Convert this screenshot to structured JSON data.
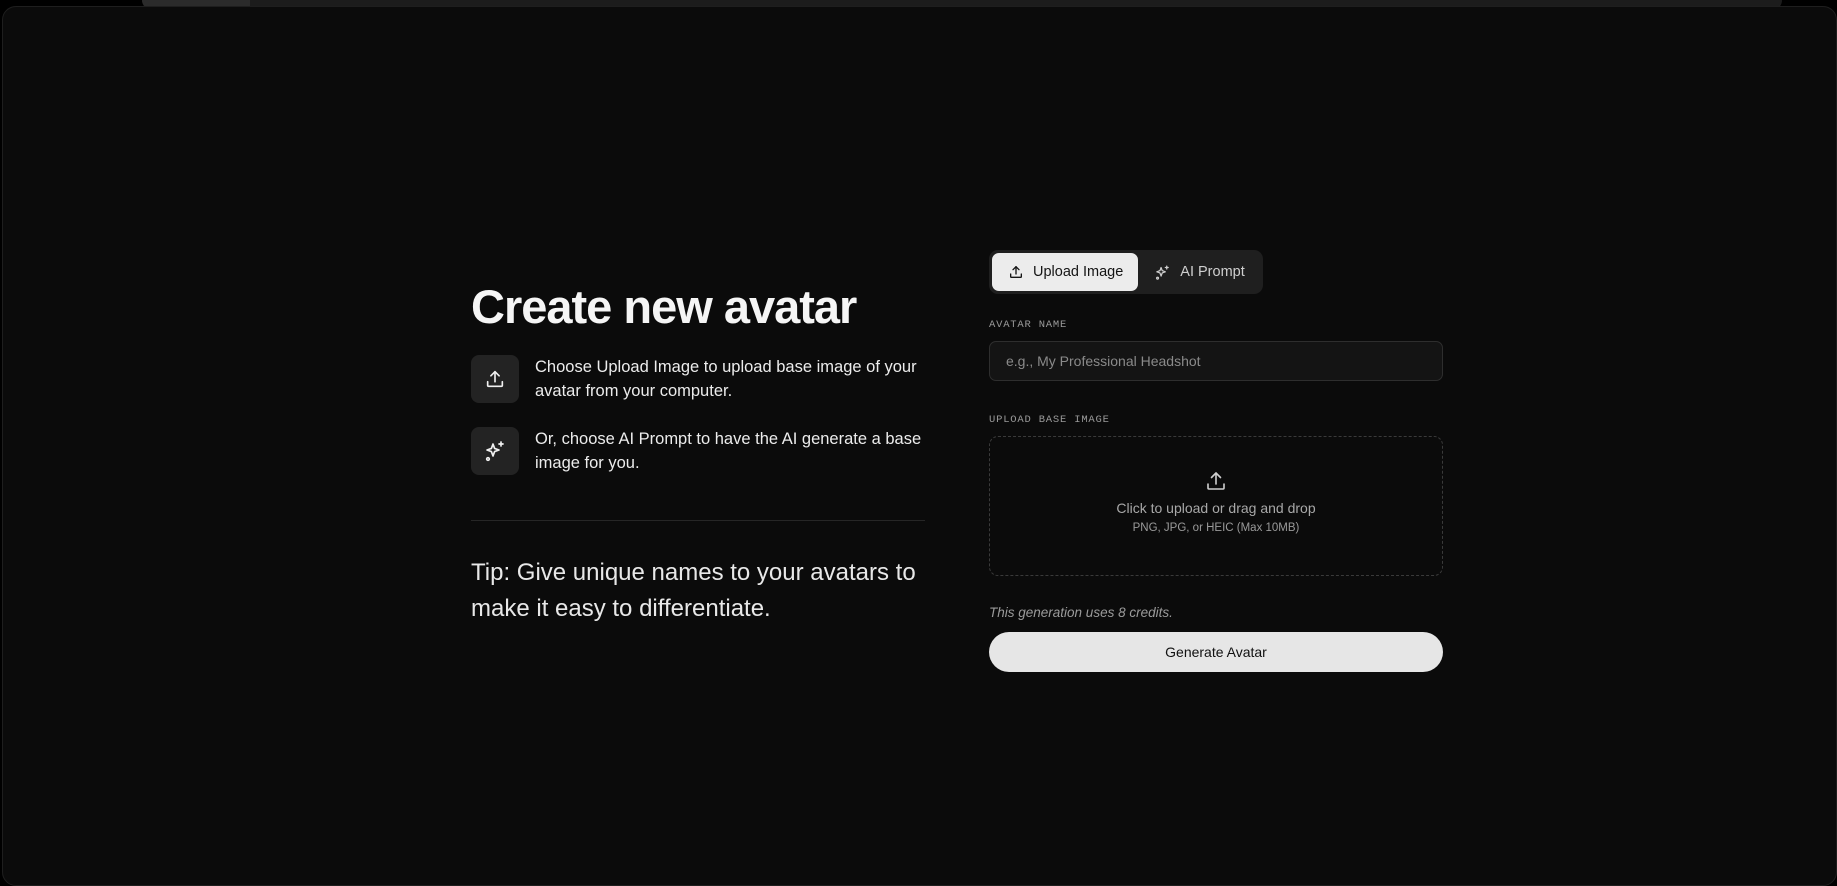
{
  "page": {
    "title": "Create new avatar"
  },
  "steps": [
    {
      "icon": "upload-icon",
      "text": "Choose Upload Image to upload base image of your avatar from your computer."
    },
    {
      "icon": "sparkles-icon",
      "text": "Or, choose AI Prompt to have the AI generate a base image for you."
    }
  ],
  "tip": "Tip: Give unique names to your avatars to make it easy to differentiate.",
  "tabs": {
    "upload": {
      "label": "Upload Image",
      "icon": "upload-icon",
      "selected": true
    },
    "ai": {
      "label": "AI Prompt",
      "icon": "sparkles-icon",
      "selected": false
    }
  },
  "form": {
    "name_label": "AVATAR NAME",
    "name_placeholder": "e.g., My Professional Headshot",
    "name_value": "",
    "upload_label": "UPLOAD BASE IMAGE",
    "dropzone_main": "Click to upload or drag and drop",
    "dropzone_sub": "PNG, JPG, or HEIC (Max 10MB)",
    "credits_note": "This generation uses 8 credits.",
    "submit_label": "Generate Avatar"
  },
  "colors": {
    "background": "#0b0b0b",
    "accent": "#e6e6e6",
    "tile": "#232323"
  }
}
